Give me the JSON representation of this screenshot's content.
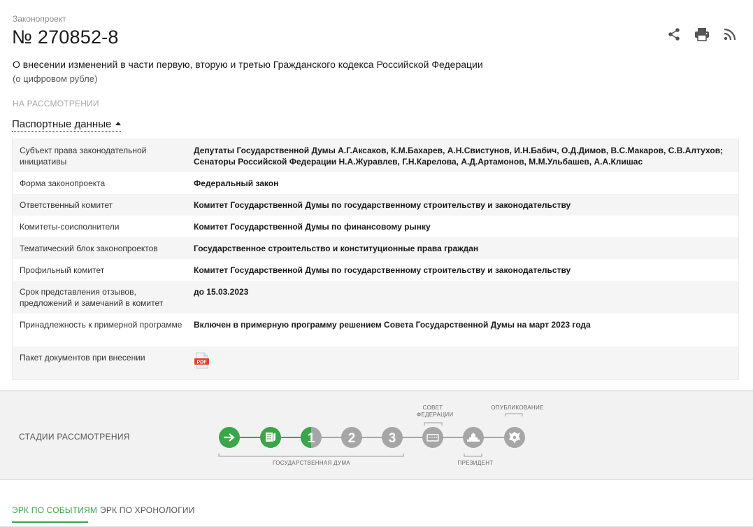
{
  "header": {
    "kind_label": "Законопроект",
    "bill_number": "№ 270852-8",
    "title": "О внесении изменений в части первую, вторую и третью Гражданского кодекса Российской Федерации",
    "subtitle": "(о цифровом рубле)",
    "status": "НА РАССМОТРЕНИИ",
    "passport_toggle": "Паспортные данные"
  },
  "icons": {
    "share": "share-icon",
    "print": "print-icon",
    "rss": "rss-icon"
  },
  "passport": [
    {
      "key": "Субъект права законодательной инициативы",
      "value": "Депутаты Государственной Думы А.Г.Аксаков, К.М.Бахарев, А.Н.Свистунов, И.Н.Бабич, О.Д.Димов, В.С.Макаров, С.В.Алтухов; Сенаторы Российской Федерации Н.А.Журавлев, Г.Н.Карелова, А.Д.Артамонов, М.М.Ульбашев, А.А.Клишас"
    },
    {
      "key": "Форма законопроекта",
      "value": "Федеральный закон"
    },
    {
      "key": "Ответственный комитет",
      "value": "Комитет Государственной Думы по государственному строительству и законодательству"
    },
    {
      "key": "Комитеты-соисполнители",
      "value": "Комитет Государственной Думы по финансовому рынку"
    },
    {
      "key": "Тематический блок законопроектов",
      "value": "Государственное строительство и конституционные права граждан"
    },
    {
      "key": "Профильный комитет",
      "value": "Комитет Государственной Думы по государственному строительству и законодательству"
    },
    {
      "key": "Срок представления отзывов, предложений и замечаний в комитет",
      "value": "до 15.03.2023"
    },
    {
      "key": "Принадлежность к примерной программе",
      "value": "Включен в примерную программу решением Совета Государственной Думы на март 2023 года"
    },
    {
      "key": "Пакет документов при внесении",
      "value": "",
      "icon": "pdf-icon"
    }
  ],
  "stages": {
    "title": "СТАДИИ РАССМОТРЕНИЯ",
    "caption_duma": "ГОСУДАРСТВЕННАЯ ДУМА",
    "caption_federation_council": "СОВЕТ ФЕДЕРАЦИИ",
    "caption_president": "ПРЕЗИДЕНТ",
    "caption_published": "ОПУБЛИКОВАНИЕ",
    "reading_1": "1",
    "reading_2": "2",
    "reading_3": "3",
    "colors": {
      "done": "#3aa54a",
      "pending": "#a6a6a6"
    }
  },
  "tabs": [
    {
      "label": "ЭРК ПО СОБЫТИЯМ",
      "active": true
    },
    {
      "label": "ЭРК ПО ХРОНОЛОГИИ",
      "active": false
    }
  ],
  "pdf_label": "PDF"
}
